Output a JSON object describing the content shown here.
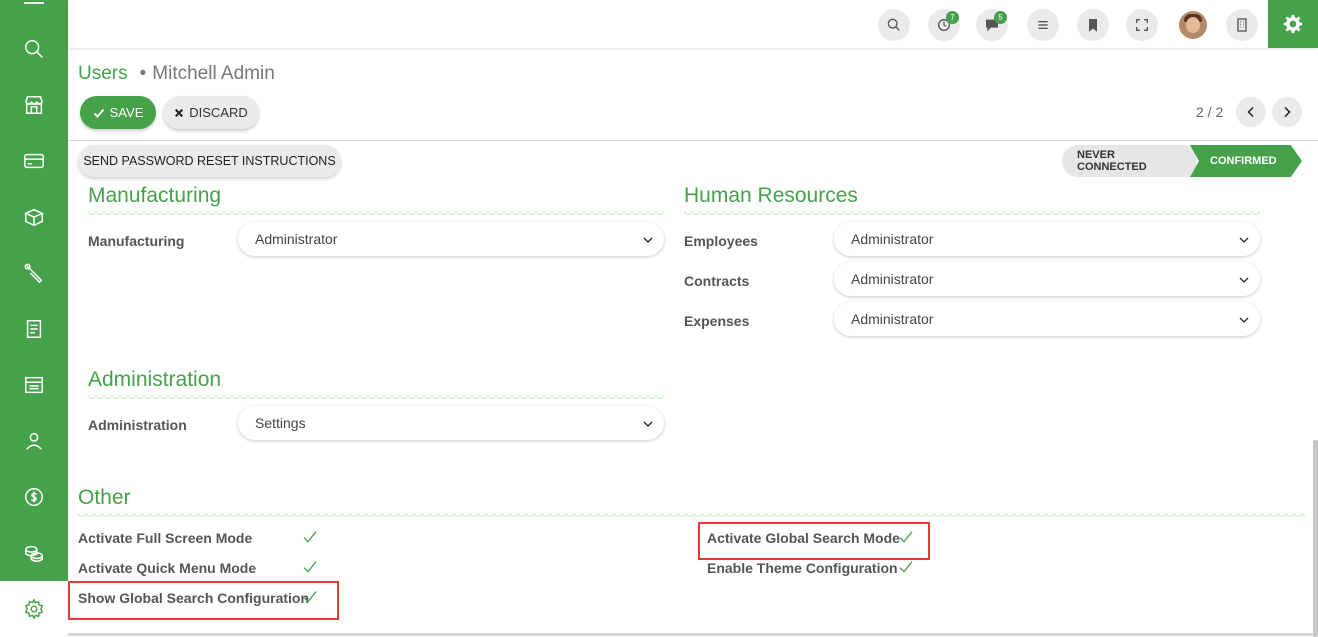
{
  "colors": {
    "brand": "#46a24a",
    "highlight": "#e53935"
  },
  "sidebar": {
    "items": [
      {
        "name": "search-icon"
      },
      {
        "name": "store-icon"
      },
      {
        "name": "card-icon"
      },
      {
        "name": "box-icon"
      },
      {
        "name": "wrench-icon"
      },
      {
        "name": "invoice-icon"
      },
      {
        "name": "ledger-icon"
      },
      {
        "name": "employee-icon"
      },
      {
        "name": "money-icon"
      },
      {
        "name": "coins-icon"
      },
      {
        "name": "settings-icon",
        "active": true
      }
    ]
  },
  "topbar": {
    "activity_badge": "7",
    "messages_badge": "5"
  },
  "breadcrumb": {
    "parent": "Users",
    "separator": "•",
    "current": "Mitchell Admin"
  },
  "toolbar": {
    "save_label": "SAVE",
    "discard_label": "DISCARD"
  },
  "pager": {
    "value": "2 / 2"
  },
  "header": {
    "reset_button": "SEND PASSWORD RESET INSTRUCTIONS",
    "status": [
      {
        "label": "NEVER CONNECTED",
        "active": false
      },
      {
        "label": "CONFIRMED",
        "active": true
      }
    ]
  },
  "groups": {
    "manufacturing": {
      "title": "Manufacturing",
      "fields": [
        {
          "label": "Manufacturing",
          "value": "Administrator"
        }
      ]
    },
    "hr": {
      "title": "Human Resources",
      "fields": [
        {
          "label": "Employees",
          "value": "Administrator"
        },
        {
          "label": "Contracts",
          "value": "Administrator"
        },
        {
          "label": "Expenses",
          "value": "Administrator"
        }
      ]
    },
    "administration": {
      "title": "Administration",
      "fields": [
        {
          "label": "Administration",
          "value": "Settings"
        }
      ]
    },
    "other": {
      "title": "Other",
      "left": [
        {
          "label": "Activate Full Screen Mode",
          "checked": true
        },
        {
          "label": "Activate Quick Menu Mode",
          "checked": true
        },
        {
          "label": "Show Global Search Configuration",
          "checked": true,
          "highlighted": true
        }
      ],
      "right": [
        {
          "label": "Activate Global Search Mode",
          "checked": true,
          "highlighted": true
        },
        {
          "label": "Enable Theme Configuration",
          "checked": true
        }
      ]
    }
  }
}
